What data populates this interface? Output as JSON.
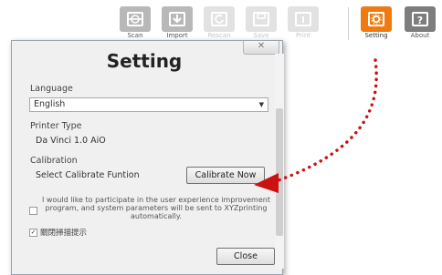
{
  "toolbar": {
    "buttons": [
      {
        "label": "Scan",
        "icon": "scan-icon",
        "state": "normal"
      },
      {
        "label": "Import",
        "icon": "import-icon",
        "state": "normal"
      },
      {
        "label": "Rescan",
        "icon": "rescan-icon",
        "state": "disabled"
      },
      {
        "label": "Save",
        "icon": "save-icon",
        "state": "disabled"
      },
      {
        "label": "Print",
        "icon": "print-icon",
        "state": "disabled"
      },
      {
        "label": "Setting",
        "icon": "gear-icon",
        "state": "active"
      },
      {
        "label": "About",
        "icon": "help-icon",
        "state": "normal"
      }
    ]
  },
  "dialog": {
    "close_glyph": "✕",
    "title": "Setting",
    "language": {
      "label": "Language",
      "value": "English"
    },
    "printer": {
      "label": "Printer Type",
      "value": "Da Vinci 1.0 AiO"
    },
    "calibration": {
      "label": "Calibration",
      "text": "Select Calibrate Funtion",
      "button": "Calibrate Now"
    },
    "participate_text": "I would like to participate in the user experience improvement program, and system parameters will be sent to XYZprinting automatically.",
    "participate_checked": false,
    "hint_text": "關閉掃描提示",
    "hint_checked": true,
    "close_label": "Close"
  },
  "colors": {
    "accent": "#ef7b10",
    "arrow": "#cc1111"
  }
}
